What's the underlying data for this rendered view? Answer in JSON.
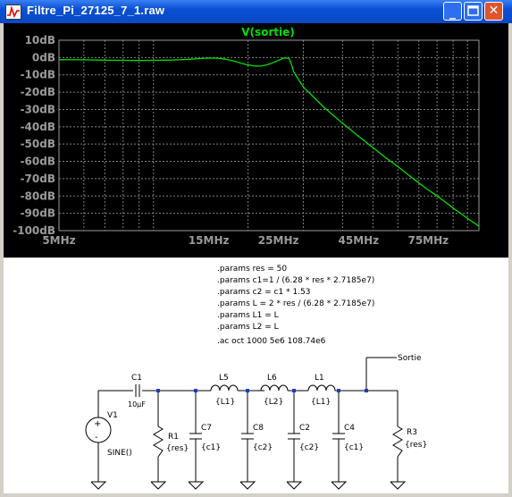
{
  "window": {
    "title": "Filtre_Pi_27125_7_1.raw",
    "minimize_label": "_",
    "close_label": "✕"
  },
  "chart_data": {
    "type": "line",
    "title": "V(sortie)",
    "xlabel": "",
    "ylabel": "",
    "x_scale": "log",
    "xlim": [
      5,
      108.74
    ],
    "ylim": [
      -100,
      10
    ],
    "grid": true,
    "xticks": [
      {
        "value": 5,
        "label": "5MHz"
      },
      {
        "value": 15,
        "label": "15MHz"
      },
      {
        "value": 25,
        "label": "25MHz"
      },
      {
        "value": 45,
        "label": "45MHz"
      },
      {
        "value": 75,
        "label": "75MHz"
      }
    ],
    "yticks": [
      {
        "value": 10,
        "label": "10dB"
      },
      {
        "value": 0,
        "label": "0dB"
      },
      {
        "value": -10,
        "label": "-10dB"
      },
      {
        "value": -20,
        "label": "-20dB"
      },
      {
        "value": -30,
        "label": "-30dB"
      },
      {
        "value": -40,
        "label": "-40dB"
      },
      {
        "value": -50,
        "label": "-50dB"
      },
      {
        "value": -60,
        "label": "-60dB"
      },
      {
        "value": -70,
        "label": "-70dB"
      },
      {
        "value": -80,
        "label": "-80dB"
      },
      {
        "value": -90,
        "label": "-90dB"
      },
      {
        "value": -100,
        "label": "-100dB"
      }
    ],
    "series": [
      {
        "name": "V(sortie)",
        "color": "#00e000",
        "x": [
          5,
          6,
          7,
          8,
          9,
          10,
          11,
          12,
          13,
          14,
          15,
          16,
          17,
          18,
          19,
          20,
          21,
          22,
          23,
          24,
          25,
          26,
          27,
          27.5,
          28,
          29,
          30,
          32,
          35,
          40,
          45,
          50,
          55,
          60,
          65,
          70,
          75,
          80,
          85,
          90,
          95,
          100,
          105,
          108.74
        ],
        "y": [
          -1.2,
          -1.3,
          -1.5,
          -1.6,
          -1.7,
          -1.6,
          -1.5,
          -1.3,
          -1.0,
          -0.6,
          -0.3,
          -0.4,
          -1.0,
          -2.0,
          -3.2,
          -4.3,
          -4.9,
          -4.9,
          -4.2,
          -3.0,
          -1.6,
          -0.3,
          -0.5,
          -4,
          -8.5,
          -13,
          -17,
          -22,
          -29,
          -38,
          -45.5,
          -52,
          -58,
          -63,
          -68,
          -72.5,
          -76.5,
          -80,
          -83.5,
          -87,
          -90,
          -93,
          -95.5,
          -97.5
        ]
      }
    ]
  },
  "schematic": {
    "directives": [
      ".params res = 50",
      ".params c1=1 / (6.28 * res * 2.7185e7)",
      ".params c2 = c1 * 1.53",
      ".params L = 2 * res / (6.28 * 2.7185e7)",
      ".params L1 = L",
      ".params L2 = L",
      ".ac oct 1000 5e6 108.74e6"
    ],
    "net_label": "Sortie",
    "v1": {
      "ref": "V1",
      "value": "SINE()"
    },
    "c1": {
      "ref": "C1",
      "value": "10µF"
    },
    "r1": {
      "ref": "R1",
      "value": "{res}"
    },
    "c7": {
      "ref": "C7",
      "value": "{c1}"
    },
    "l5": {
      "ref": "L5",
      "value": "{L1}"
    },
    "c8": {
      "ref": "C8",
      "value": "{c2}"
    },
    "l6": {
      "ref": "L6",
      "value": "{L2}"
    },
    "c2": {
      "ref": "C2",
      "value": "{c2}"
    },
    "l1": {
      "ref": "L1",
      "value": "{L1}"
    },
    "c4": {
      "ref": "C4",
      "value": "{c1}"
    },
    "r3": {
      "ref": "R3",
      "value": "{res}"
    }
  }
}
